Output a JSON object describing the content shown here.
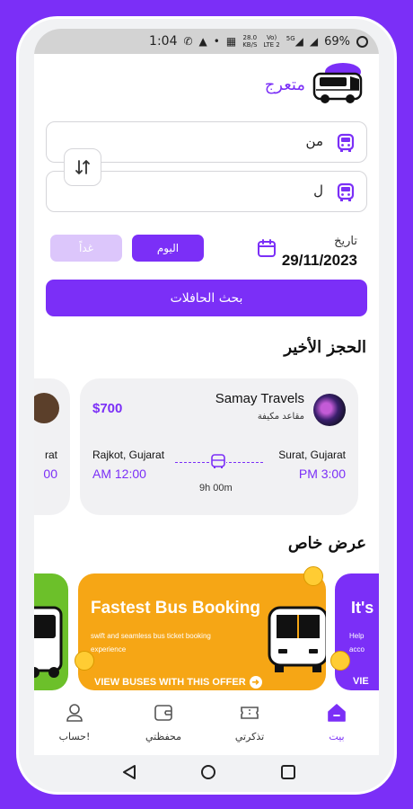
{
  "status_bar": {
    "time": "1:04",
    "net_speed_top": "28.0",
    "net_speed_bottom": "KB/S",
    "volte_top": "Vo)",
    "volte_bottom": "LTE 2",
    "signal_label": "5G",
    "battery": "69%"
  },
  "brand": {
    "name": "متعرج"
  },
  "search_form": {
    "from_label": "من",
    "to_label": "ل",
    "date_label": "تاريخ",
    "date_value": "29/11/2023",
    "today_chip": "اليوم",
    "tomorrow_chip": "غداً",
    "search_button": "بحث الحافلات"
  },
  "recent_booking": {
    "title": "الحجز الأخير",
    "cards": [
      {
        "operator": "Samay Travels",
        "seat_type": "مقاعد مكيفة",
        "price": "$700",
        "from_city": "Rajkot, Gujarat",
        "to_city": "Surat, Gujarat",
        "departure": "AM 12:00",
        "arrival": "PM 3:00",
        "duration": "9h 00m"
      }
    ],
    "partial_card": {
      "city": "rat",
      "time": "00"
    }
  },
  "special_offer": {
    "title": "عرض خاص",
    "offers": [
      {
        "title": "Fastest Bus Booking",
        "subtitle": "swift and seamless bus ticket booking experience",
        "cta": "VIEW BUSES WITH THIS OFFER",
        "color": "#f6a615"
      },
      {
        "title": "It's",
        "subtitle_line1": "Help",
        "subtitle_line2": "acco",
        "cta": "VIE",
        "color": "#7b2ff7"
      }
    ],
    "left_offer_color": "#6cc02a"
  },
  "bottom_nav": {
    "items": [
      {
        "label": "حساب!",
        "icon": "user-icon"
      },
      {
        "label": "محفظتي",
        "icon": "wallet-icon"
      },
      {
        "label": "تذكرتي",
        "icon": "ticket-icon"
      },
      {
        "label": "بيت",
        "icon": "home-icon"
      }
    ],
    "active": "بيت"
  },
  "theme": {
    "accent": "#7b2ff7",
    "accent_light": "#dcc6fb",
    "card_bg": "#f1f1f3"
  }
}
